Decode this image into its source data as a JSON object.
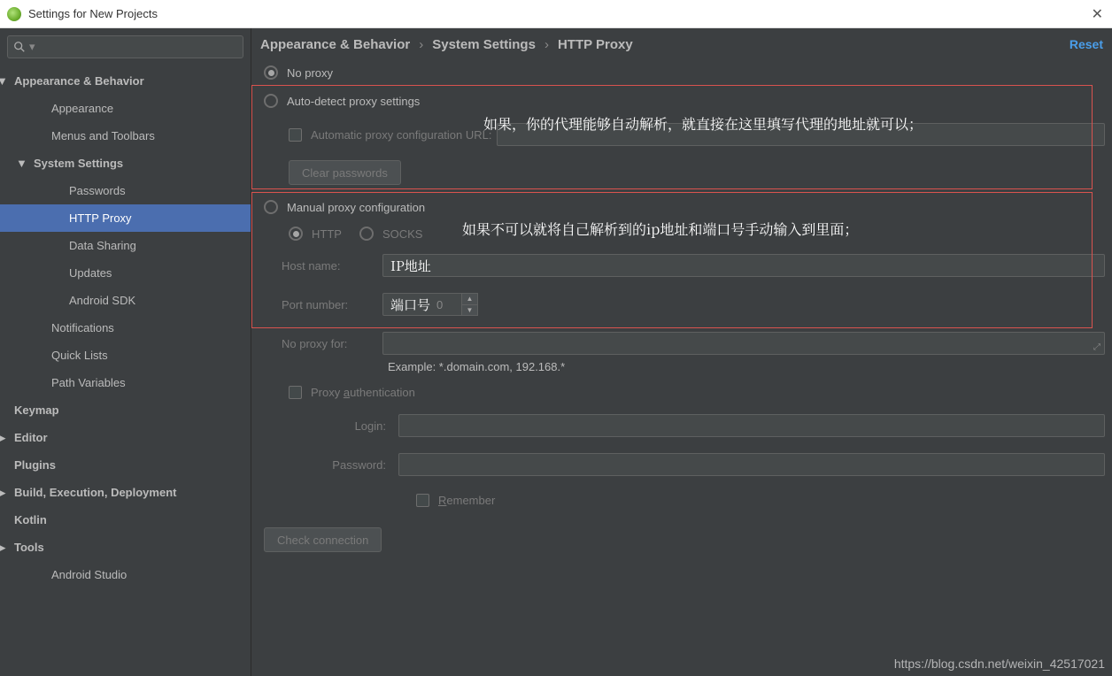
{
  "titlebar": {
    "title": "Settings for New Projects"
  },
  "sidebar": {
    "search_placeholder": "",
    "items": [
      {
        "label": "Appearance & Behavior",
        "level": "level-0",
        "tw": "▼"
      },
      {
        "label": "Appearance",
        "level": "level-1"
      },
      {
        "label": "Menus and Toolbars",
        "level": "level-1"
      },
      {
        "label": "System Settings",
        "level": "level-1b",
        "tw": "▼"
      },
      {
        "label": "Passwords",
        "level": "level-2"
      },
      {
        "label": "HTTP Proxy",
        "level": "level-2",
        "selected": true
      },
      {
        "label": "Data Sharing",
        "level": "level-2"
      },
      {
        "label": "Updates",
        "level": "level-2"
      },
      {
        "label": "Android SDK",
        "level": "level-2"
      },
      {
        "label": "Notifications",
        "level": "level-1"
      },
      {
        "label": "Quick Lists",
        "level": "level-1"
      },
      {
        "label": "Path Variables",
        "level": "level-1"
      },
      {
        "label": "Keymap",
        "level": "level-0"
      },
      {
        "label": "Editor",
        "level": "level-0",
        "tw": "▶"
      },
      {
        "label": "Plugins",
        "level": "level-0"
      },
      {
        "label": "Build, Execution, Deployment",
        "level": "level-0",
        "tw": "▶"
      },
      {
        "label": "Kotlin",
        "level": "level-0"
      },
      {
        "label": "Tools",
        "level": "level-0",
        "tw": "▶"
      },
      {
        "label": "Android Studio",
        "level": "level-1"
      }
    ]
  },
  "breadcrumb": {
    "a": "Appearance & Behavior",
    "b": "System Settings",
    "c": "HTTP Proxy",
    "reset": "Reset"
  },
  "form": {
    "no_proxy": "No proxy",
    "auto_detect": "Auto-detect proxy settings",
    "auto_url_label": "Automatic proxy configuration URL:",
    "clear_passwords": "Clear passwords",
    "manual": "Manual proxy configuration",
    "http": "HTTP",
    "socks": "SOCKS",
    "host_label": "Host name:",
    "host_value": "",
    "port_label": "Port number:",
    "port_value": "0",
    "no_proxy_for": "No proxy for:",
    "example": "Example: *.domain.com, 192.168.*",
    "proxy_auth": "Proxy authentication",
    "login": "Login:",
    "password": "Password:",
    "remember": "Remember",
    "check_conn": "Check connection"
  },
  "annotations": {
    "box1_note": "如果，你的代理能够自动解析，就直接在这里填写代理的地址就可以；",
    "box2_note": "如果不可以就将自己解析到的ip地址和端口号手动输入到里面；",
    "ip_label": "IP地址",
    "port_label": "端口号"
  },
  "watermark": "https://blog.csdn.net/weixin_42517021"
}
